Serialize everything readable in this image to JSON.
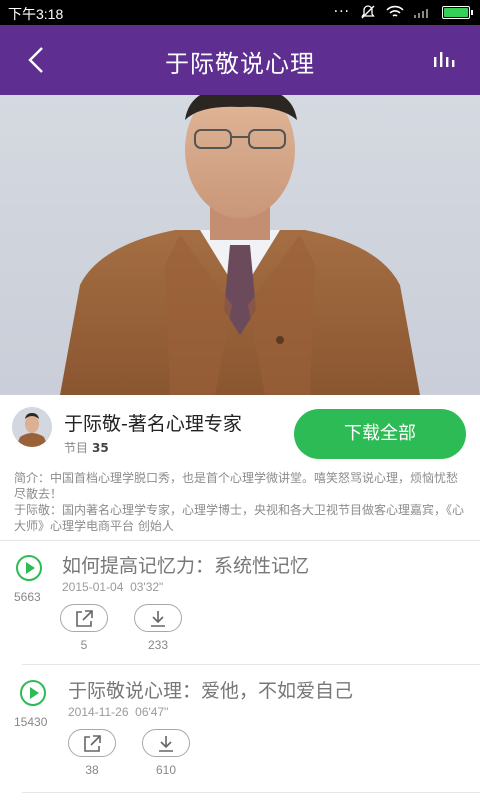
{
  "status": {
    "time": "下午3:18",
    "battery_level": 1.0
  },
  "header": {
    "title": "于际敬说心理",
    "back_icon": "back-arrow-icon",
    "stats_icon": "bar-chart-icon"
  },
  "program": {
    "name": "于际敬-著名心理专家",
    "count_label": "节目",
    "count": "35",
    "download_all": "下载全部",
    "intro": "简介：中国首档心理学脱口秀，也是首个心理学微讲堂。嘻笑怒骂说心理，烦恼忧愁尽散去！\n于际敬：国内著名心理学专家，心理学博士，央视和各大卫视节目做客心理嘉宾，《心大师》心理学电商平台 创始人"
  },
  "episodes": [
    {
      "title": "如何提高记忆力：系统性记忆",
      "date": "2015-01-04",
      "duration": "03'32\"",
      "plays": "5663",
      "shares": "5",
      "downloads": "233"
    },
    {
      "title": "于际敬说心理：爱他，不如爱自己",
      "date": "2014-11-26",
      "duration": "06'47\"",
      "plays": "15430",
      "shares": "38",
      "downloads": "610"
    }
  ],
  "colors": {
    "header": "#5e2f91",
    "accent": "#2dbb55",
    "status_bar": "#000000"
  }
}
